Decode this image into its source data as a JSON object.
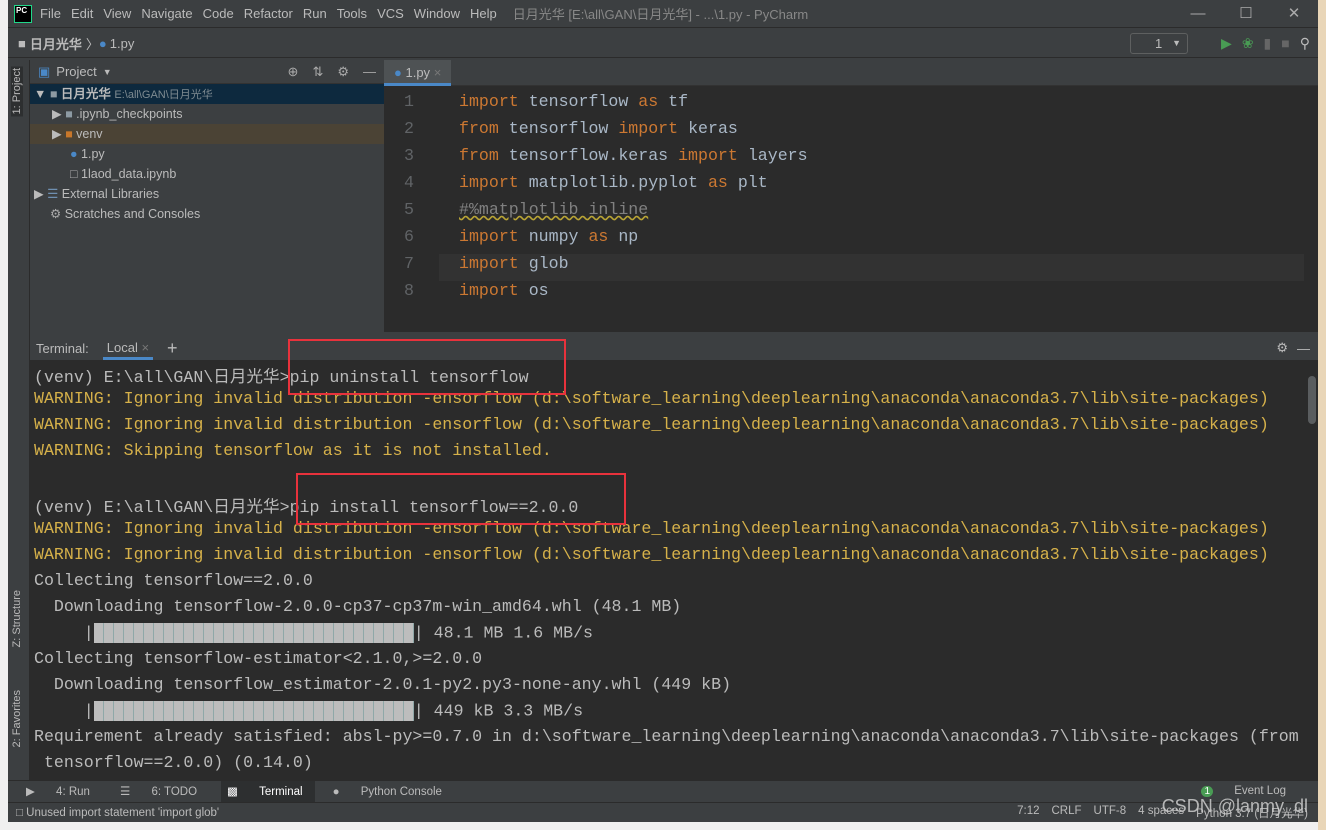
{
  "window": {
    "title": "日月光华 [E:\\all\\GAN\\日月光华] - ...\\1.py - PyCharm",
    "logo": "PC"
  },
  "menu": [
    "File",
    "Edit",
    "View",
    "Navigate",
    "Code",
    "Refactor",
    "Run",
    "Tools",
    "VCS",
    "Window",
    "Help"
  ],
  "breadcrumb": {
    "project": "日月光华",
    "file": "1.py"
  },
  "run_config": "1",
  "project_panel": {
    "title": "Project",
    "items": [
      {
        "label": "日月光华",
        "path": "E:\\all\\GAN\\日月光华"
      },
      {
        "label": ".ipynb_checkpoints"
      },
      {
        "label": "venv"
      },
      {
        "label": "1.py"
      },
      {
        "label": "1laod_data.ipynb"
      },
      {
        "label": "External Libraries"
      },
      {
        "label": "Scratches and Consoles"
      }
    ]
  },
  "side_tabs": {
    "project": "1: Project",
    "structure": "Z: Structure",
    "favorites": "2: Favorites"
  },
  "editor": {
    "tab": "1.py",
    "lines": [
      {
        "n": "1",
        "kw": "import",
        "rest": " tensorflow ",
        "kw2": "as",
        "rest2": " tf"
      },
      {
        "n": "2",
        "text": "from tensorflow import keras"
      },
      {
        "n": "3",
        "text": "from tensorflow.keras import layers"
      },
      {
        "n": "4",
        "text": "import matplotlib.pyplot as plt"
      },
      {
        "n": "5",
        "comment": "#%matplotlib inline"
      },
      {
        "n": "6",
        "text": "import numpy as np"
      },
      {
        "n": "7",
        "text": "import glob"
      },
      {
        "n": "8",
        "text": "import os"
      }
    ]
  },
  "terminal": {
    "label": "Terminal:",
    "tab": "Local",
    "lines": [
      {
        "t": "(venv) E:\\all\\GAN\\日月光华>pip uninstall tensorflow"
      },
      {
        "t": "WARNING: Ignoring invalid distribution -ensorflow (d:\\software_learning\\deeplearning\\anaconda\\anaconda3.7\\lib\\site-packages)",
        "warn": true
      },
      {
        "t": "WARNING: Ignoring invalid distribution -ensorflow (d:\\software_learning\\deeplearning\\anaconda\\anaconda3.7\\lib\\site-packages)",
        "warn": true
      },
      {
        "t": "WARNING: Skipping tensorflow as it is not installed.",
        "warn": true
      },
      {
        "t": ""
      },
      {
        "t": "(venv) E:\\all\\GAN\\日月光华>pip install tensorflow==2.0.0"
      },
      {
        "t": "WARNING: Ignoring invalid distribution -ensorflow (d:\\software_learning\\deeplearning\\anaconda\\anaconda3.7\\lib\\site-packages)",
        "warn": true
      },
      {
        "t": "WARNING: Ignoring invalid distribution -ensorflow (d:\\software_learning\\deeplearning\\anaconda\\anaconda3.7\\lib\\site-packages)",
        "warn": true
      },
      {
        "t": "Collecting tensorflow==2.0.0"
      },
      {
        "t": "  Downloading tensorflow-2.0.0-cp37-cp37m-win_amd64.whl (48.1 MB)"
      },
      {
        "bar": true,
        "t": "| 48.1 MB 1.6 MB/s",
        "progress": 100
      },
      {
        "t": "Collecting tensorflow-estimator<2.1.0,>=2.0.0"
      },
      {
        "t": "  Downloading tensorflow_estimator-2.0.1-py2.py3-none-any.whl (449 kB)"
      },
      {
        "bar": true,
        "t": "| 449 kB 3.3 MB/s",
        "progress": 100
      },
      {
        "t": "Requirement already satisfied: absl-py>=0.7.0 in d:\\software_learning\\deeplearning\\anaconda\\anaconda3.7\\lib\\site-packages (from"
      },
      {
        "t": " tensorflow==2.0.0) (0.14.0)"
      }
    ]
  },
  "bottom_tools": [
    "4: Run",
    "6: TODO",
    "Terminal",
    "Python Console"
  ],
  "event_log": {
    "label": "Event Log",
    "count": "1"
  },
  "status": {
    "message": "Unused import statement 'import glob'",
    "position": "7:12",
    "line_sep": "CRLF",
    "encoding": "UTF-8",
    "indent": "4 spaces",
    "interpreter": "Python 3.7 (日月光华)"
  },
  "watermark": "CSDN @lanmy_dl",
  "colors": {
    "keyword": "#cc7832",
    "warning": "#d6b14a",
    "highlight_box": "#e8323c",
    "accent": "#4a88c7"
  }
}
